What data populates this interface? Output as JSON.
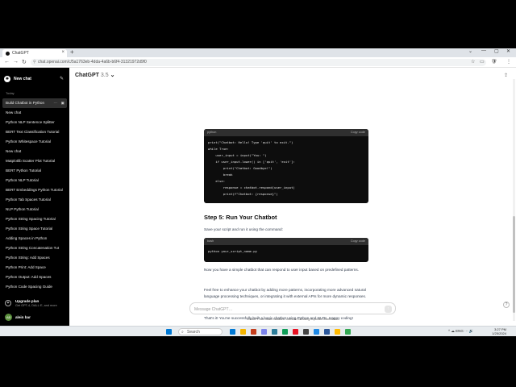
{
  "browser": {
    "tab_title": "ChatGPT",
    "new_tab_symbol": "+",
    "tab_close_symbol": "×",
    "address": "chat.openai.com/c/5a1763eb-4dda-4a6b-b6f4-31321972d9f0",
    "window_controls": [
      "⌄",
      "—",
      "▢",
      "✕"
    ],
    "nav_symbols": [
      "←",
      "→",
      "↻"
    ],
    "toolbar_symbols": [
      "☆",
      "▭",
      "🛡",
      "⋮"
    ]
  },
  "sidebar": {
    "new_chat_label": "New chat",
    "logo_symbol": "✺",
    "edit_symbol": "✎",
    "today_label": "Today",
    "items": [
      {
        "label": "Build Chatbot in Python",
        "active": true
      },
      {
        "label": "New chat"
      },
      {
        "label": "Python NLP Sentence Splitter"
      },
      {
        "label": "BERT Text Classification Tutorial"
      },
      {
        "label": "Python Whitespace Tutorial"
      },
      {
        "label": "New chat"
      },
      {
        "label": "Matplotlib Scatter Plot Tutorial"
      },
      {
        "label": "BERT Python Tutorial"
      },
      {
        "label": "Python NLP Tutorial"
      },
      {
        "label": "BERT Embeddings Python Tutorial"
      },
      {
        "label": "Python Tab Spaces Tutorial"
      },
      {
        "label": "NLP Python Tutorial"
      },
      {
        "label": "Python String Spacing Tutorial"
      },
      {
        "label": "Python String Space Tutorial"
      },
      {
        "label": "Adding Spaces in Python"
      },
      {
        "label": "Python String Concatenation Tut"
      },
      {
        "label": "Python String: Add Spaces"
      },
      {
        "label": "Python Print: Add Space"
      },
      {
        "label": "Python Output: Add Spaces"
      },
      {
        "label": "Python Code Spacing Guide"
      }
    ],
    "item_dots": "···",
    "item_archive": "▣",
    "upgrade": {
      "title": "Upgrade plan",
      "subtitle": "Get GPT-4, DALL·E, and more",
      "icon_symbol": "✦"
    },
    "user": {
      "initials": "AB",
      "name": "alein bar"
    }
  },
  "main": {
    "model_name": "ChatGPT",
    "model_version": "3.5",
    "model_chevron": "⌄",
    "share_symbol": "⇪",
    "code1": {
      "lang": "python",
      "copy_label": "Copy code",
      "lines": [
        "print(\"Chatbot: Hello! Type 'quit' to exit.\")",
        "while True:",
        "    user_input = input(\"You: \")",
        "    if user_input.lower() in ['quit', 'exit']:",
        "        print(\"Chatbot: Goodbye!\")",
        "        break",
        "    else:",
        "        response = chatbot.respond(user_input)",
        "        print(f\"Chatbot: {response}\")"
      ]
    },
    "step5_heading": "Step 5: Run Your Chatbot",
    "step5_text": "Save your script and run it using the command:",
    "code2": {
      "lang": "bash",
      "copy_label": "Copy code",
      "line": "python your_script_name.py"
    },
    "para1": "Now you have a simple chatbot that can respond to user input based on predefined patterns.",
    "para2": "Feel free to enhance your chatbot by adding more patterns, incorporating more advanced natural language processing techniques, or integrating it with external APIs for more dynamic responses.",
    "para3": "That's it! You've successfully built a basic chatbot using Python and NLTK. Happy coding!",
    "actions": [
      "⧉",
      "👍",
      "👎",
      "↻"
    ],
    "composer_placeholder": "Message ChatGPT…",
    "send_symbol": "↑",
    "disclaimer": "ChatGPT can make mistakes. Consider checking important information.",
    "help_symbol": "?"
  },
  "taskbar": {
    "search_label": "Search",
    "search_symbol": "⌕",
    "tray": "^  ☁  ENG  ⋯  🔊",
    "time": "3:27 PM",
    "date": "1/25/2024",
    "app_colors": [
      "#0078d4",
      "#f4b400",
      "#c43e1c",
      "#7b83eb",
      "#2d7d9a",
      "#0f9d58",
      "#e81123",
      "#444444",
      "#1e88e5",
      "#2b579a",
      "#ffb900",
      "#34a853"
    ]
  }
}
